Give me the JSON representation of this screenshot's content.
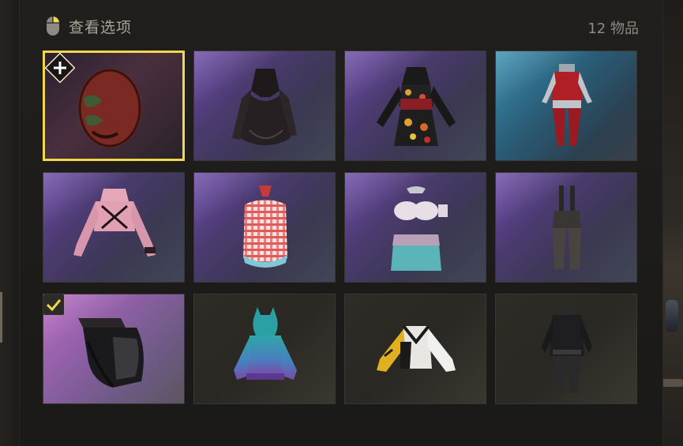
{
  "header": {
    "title": "查看选项",
    "count": "12 物品",
    "icon": "mouse-icon"
  },
  "colors": {
    "selected_border": "#f2d64b",
    "check": "#f2d64b"
  },
  "items": [
    {
      "icon": "mask-icon",
      "background": "dark-red",
      "selected": true,
      "badge": "add-icon"
    },
    {
      "icon": "black-lace-dress-icon",
      "background": "purple"
    },
    {
      "icon": "floral-cheongsam-dress-icon",
      "background": "purple"
    },
    {
      "icon": "red-suit-icon",
      "background": "cyan"
    },
    {
      "icon": "pink-crop-top-icon",
      "background": "purple"
    },
    {
      "icon": "plaid-swimsuit-icon",
      "background": "purple"
    },
    {
      "icon": "mermaid-outfit-icon",
      "background": "purple"
    },
    {
      "icon": "dark-overalls-icon",
      "background": "purple"
    },
    {
      "icon": "black-face-mask-icon",
      "background": "pink",
      "checked": true
    },
    {
      "icon": "gradient-hoodie-icon",
      "background": "dark"
    },
    {
      "icon": "yellow-jacket-icon",
      "background": "dark"
    },
    {
      "icon": "black-outfit-icon",
      "background": "dark"
    }
  ]
}
